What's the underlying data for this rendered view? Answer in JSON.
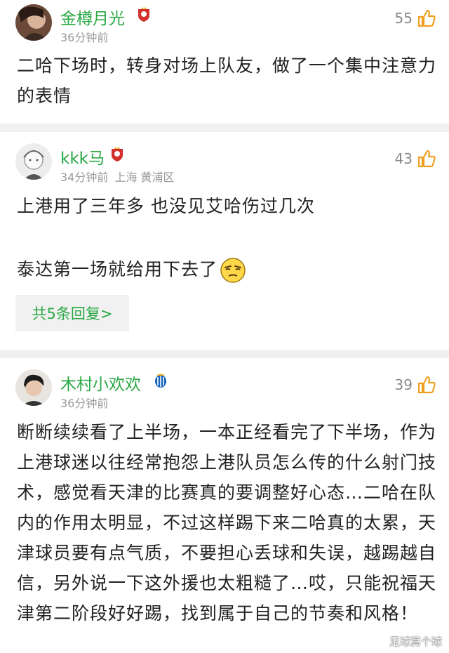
{
  "comments": [
    {
      "username": "金樽月光",
      "time": "36分钟前",
      "location": "",
      "likes": "55",
      "text": "二哈下场时，转身对场上队友，做了一个集中注意力的表情"
    },
    {
      "username": "kkk马",
      "time": "34分钟前",
      "location": "上海 黄浦区",
      "likes": "43",
      "text_line1": "上港用了三年多 也没见艾哈伤过几次",
      "text_line2": "泰达第一场就给用下去了",
      "reply_label": "共5条回复>"
    },
    {
      "username": "木村小欢欢",
      "time": "36分钟前",
      "location": "",
      "likes": "39",
      "text": "断断续续看了上半场，一本正经看完了下半场，作为上港球迷以往经常抱怨上港队员怎么传的什么射门技术，感觉看天津的比赛真的要调整好心态…二哈在队内的作用太明显，不过这样踢下来二哈真的太累，天津球员要有点气质，不要担心丢球和失误，越踢越自信，另外说一下这外援也太粗糙了…哎，只能祝福天津第二阶段好好踢，找到属于自己的节奏和风格！"
    }
  ],
  "watermark": "足球算个球",
  "colors": {
    "username": "#2aa845",
    "like_icon": "#f0a020",
    "separator": "#f0f0f0",
    "meta": "#999999"
  },
  "icons": [
    "thumbs-up-icon",
    "team-badge-icon",
    "squint-emoji-icon"
  ]
}
